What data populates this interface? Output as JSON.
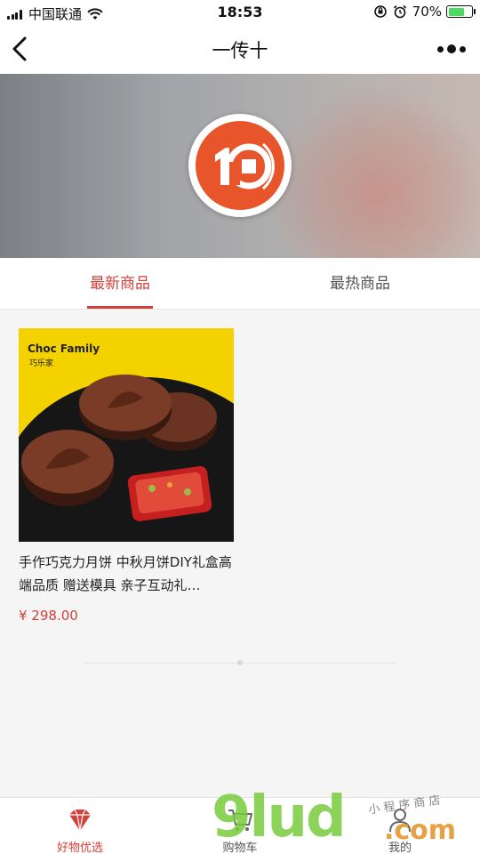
{
  "status_bar": {
    "carrier": "中国联通",
    "time": "18:53",
    "battery_percent": "70%",
    "battery_level": 0.7,
    "icons": [
      "signal-icon",
      "wifi-icon",
      "orientation-lock-icon",
      "alarm-icon",
      "battery-icon"
    ]
  },
  "nav": {
    "title": "一传十",
    "back_icon": "chevron-left-icon",
    "more_icon": "more-dots-icon"
  },
  "banner": {
    "logo": "store-logo"
  },
  "tabs": [
    {
      "label": "最新商品",
      "active": true
    },
    {
      "label": "最热商品",
      "active": false
    }
  ],
  "products": [
    {
      "title": "手作巧克力月饼 中秋月饼DIY礼盒高端品质 赠送模具 亲子互动礼…",
      "price": "¥ 298.00",
      "image_brand": "Choc Family",
      "image_brand_cn": "巧乐家"
    }
  ],
  "tabbar": [
    {
      "label": "好物优选",
      "icon": "diamond-icon",
      "active": true
    },
    {
      "label": "购物车",
      "icon": "cart-icon",
      "active": false
    },
    {
      "label": "我的",
      "icon": "user-icon",
      "active": false
    }
  ],
  "watermark": {
    "text": "9lud",
    "suffix": ".com",
    "tagline": "小 程 序 商 店"
  },
  "colors": {
    "accent": "#d4403a",
    "logo_orange": "#e8552a"
  }
}
